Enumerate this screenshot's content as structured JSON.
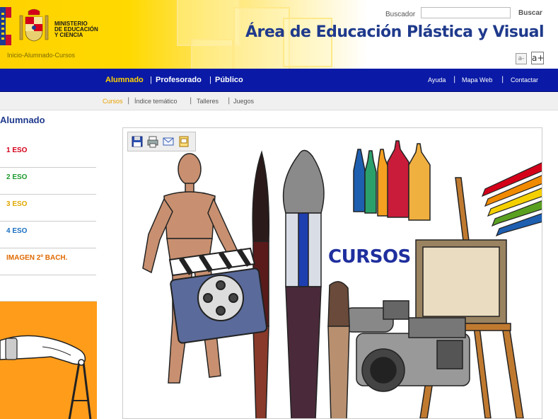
{
  "header": {
    "ministry_line1": "MINISTERIO",
    "ministry_line2": "DE EDUCACIÓN",
    "ministry_line3": "Y CIENCIA",
    "breadcrumb": "Inicio-Alumnado-Cursos",
    "search_label": "Buscador",
    "search_value": "",
    "search_button": "Buscar",
    "site_title": "Área de Educación Plástica y Visual",
    "font_decrease": "a-",
    "font_increase": "a+"
  },
  "main_nav": {
    "left": [
      {
        "label": "Alumnado",
        "active": true
      },
      {
        "label": "Profesorado",
        "active": false
      },
      {
        "label": "Público",
        "active": false
      }
    ],
    "right": [
      {
        "label": "Ayuda"
      },
      {
        "label": "Mapa Web"
      },
      {
        "label": "Contactar"
      }
    ]
  },
  "sub_nav": [
    {
      "label": "Cursos",
      "active": true
    },
    {
      "label": "Índice temático",
      "active": false
    },
    {
      "label": "Talleres",
      "active": false
    },
    {
      "label": "Juegos",
      "active": false
    }
  ],
  "sidebar": {
    "title": "Alumnado",
    "items": [
      {
        "label": "1 ESO",
        "color": "#d4001a"
      },
      {
        "label": "2 ESO",
        "color": "#1e9a2e"
      },
      {
        "label": "3 ESO",
        "color": "#e0a800"
      },
      {
        "label": "4 ESO",
        "color": "#1a6fc0"
      },
      {
        "label": "IMAGEN 2º BACH.",
        "color": "#e06a00"
      }
    ]
  },
  "content": {
    "illustration_label": "CURSOS",
    "toolbar_icons": [
      "save-icon",
      "print-icon",
      "email-icon",
      "printer-alt-icon"
    ]
  },
  "colors": {
    "nav_bg": "#0a1aa6",
    "title_blue": "#1f3a8c",
    "accent_yellow": "#ffd200"
  }
}
